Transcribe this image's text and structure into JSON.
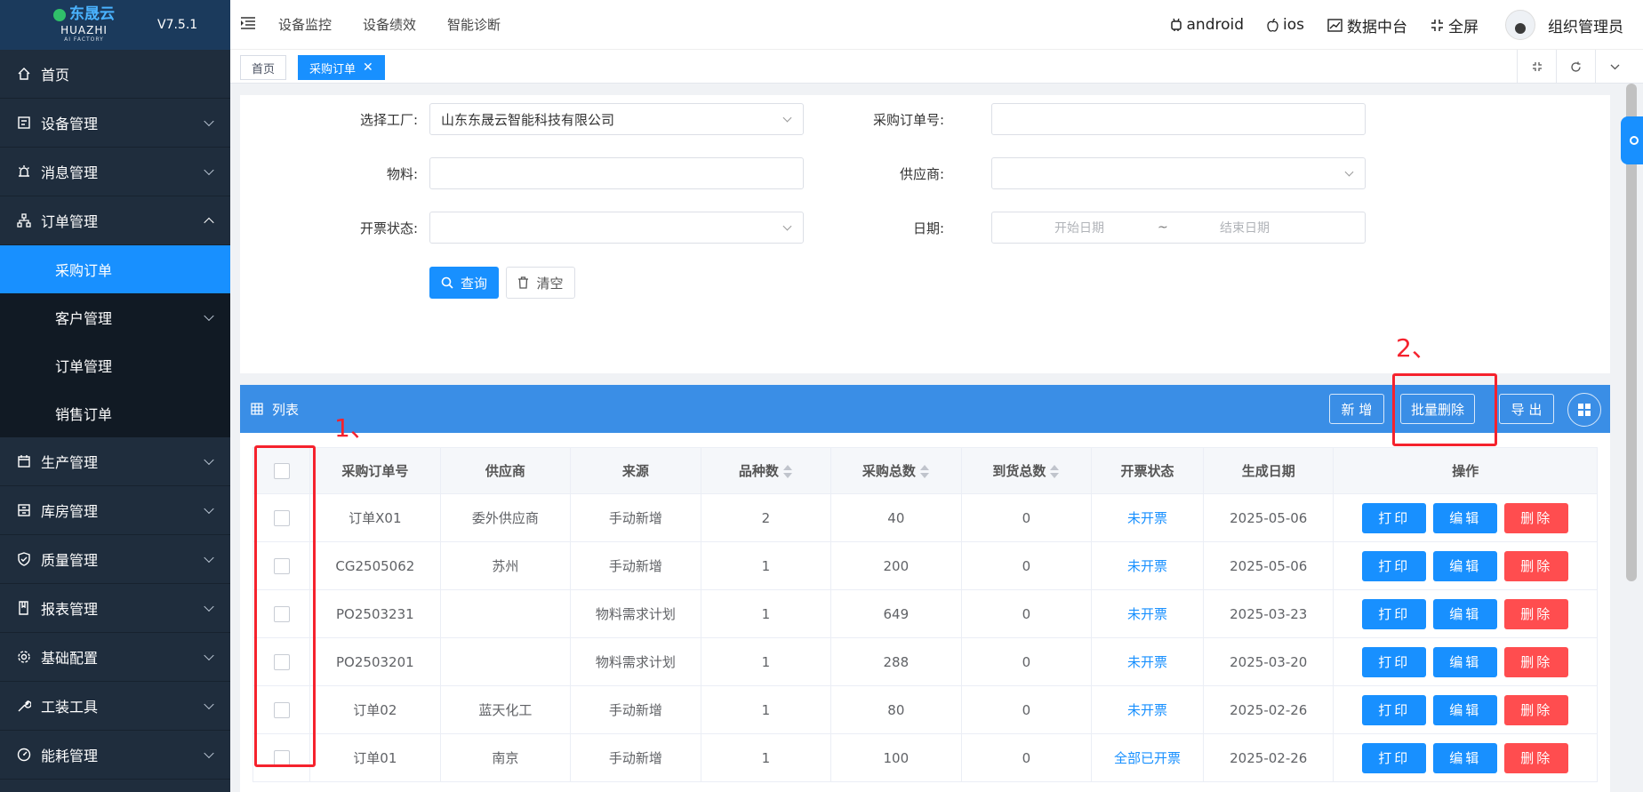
{
  "logo": {
    "cn": "东晟云",
    "en": "HUAZHI",
    "sub": "AI FACTORY",
    "version": "V7.5.1"
  },
  "sidebar": {
    "items": [
      {
        "label": "首页",
        "icon": "home-icon"
      },
      {
        "label": "设备管理",
        "icon": "device-icon"
      },
      {
        "label": "消息管理",
        "icon": "alarm-icon"
      },
      {
        "label": "订单管理",
        "icon": "org-tree-icon"
      },
      {
        "label": "生产管理",
        "icon": "calendar-icon"
      },
      {
        "label": "库房管理",
        "icon": "warehouse-icon"
      },
      {
        "label": "质量管理",
        "icon": "shield-check-icon"
      },
      {
        "label": "报表管理",
        "icon": "book-icon"
      },
      {
        "label": "基础配置",
        "icon": "gear-icon"
      },
      {
        "label": "工装工具",
        "icon": "wrench-icon"
      },
      {
        "label": "能耗管理",
        "icon": "gauge-icon"
      }
    ],
    "sub_items": [
      {
        "label": "采购订单"
      },
      {
        "label": "客户管理"
      },
      {
        "label": "订单管理"
      },
      {
        "label": "销售订单"
      }
    ]
  },
  "header": {
    "nav": [
      "设备监控",
      "设备绩效",
      "智能诊断"
    ],
    "android": "android",
    "ios": "ios",
    "data_center": "数据中台",
    "fullscreen": "全屏",
    "user": "组织管理员"
  },
  "tabs": [
    {
      "label": "首页"
    },
    {
      "label": "采购订单"
    }
  ],
  "search": {
    "factory_label": "选择工厂:",
    "factory_value": "山东东晟云智能科技有限公司",
    "order_no_label": "采购订单号:",
    "material_label": "物料:",
    "supplier_label": "供应商:",
    "invoice_label": "开票状态:",
    "date_label": "日期:",
    "date_start": "开始日期",
    "date_sep": "~",
    "date_end": "结束日期",
    "query_btn": "查询",
    "clear_btn": "清空"
  },
  "list": {
    "title": "列表",
    "add_btn": "新 增",
    "batch_delete_btn": "批量删除",
    "export_btn": "导 出",
    "columns": [
      "采购订单号",
      "供应商",
      "来源",
      "品种数",
      "采购总数",
      "到货总数",
      "开票状态",
      "生成日期",
      "操作"
    ],
    "rows": [
      {
        "order_no": "订单X01",
        "supplier": "委外供应商",
        "source": "手动新增",
        "kinds": "2",
        "total": "40",
        "arrived": "0",
        "invoice": "未开票",
        "date": "2025-05-06"
      },
      {
        "order_no": "CG2505062",
        "supplier": "苏州",
        "source": "手动新增",
        "kinds": "1",
        "total": "200",
        "arrived": "0",
        "invoice": "未开票",
        "date": "2025-05-06"
      },
      {
        "order_no": "PO2503231",
        "supplier": "",
        "source": "物料需求计划",
        "kinds": "1",
        "total": "649",
        "arrived": "0",
        "invoice": "未开票",
        "date": "2025-03-23"
      },
      {
        "order_no": "PO2503201",
        "supplier": "",
        "source": "物料需求计划",
        "kinds": "1",
        "total": "288",
        "arrived": "0",
        "invoice": "未开票",
        "date": "2025-03-20"
      },
      {
        "order_no": "订单02",
        "supplier": "蓝天化工",
        "source": "手动新增",
        "kinds": "1",
        "total": "80",
        "arrived": "0",
        "invoice": "未开票",
        "date": "2025-02-26"
      },
      {
        "order_no": "订单01",
        "supplier": "南京",
        "source": "手动新增",
        "kinds": "1",
        "total": "100",
        "arrived": "0",
        "invoice": "全部已开票",
        "date": "2025-02-26"
      }
    ],
    "op_print": "打印",
    "op_edit": "编辑",
    "op_delete": "删除"
  },
  "annotations": {
    "one": "1、",
    "two": "2、"
  },
  "colors": {
    "primary": "#1890ff",
    "danger": "#ff4d4f",
    "sidebar": "#1f2d3d",
    "annotation": "#f5222d"
  }
}
